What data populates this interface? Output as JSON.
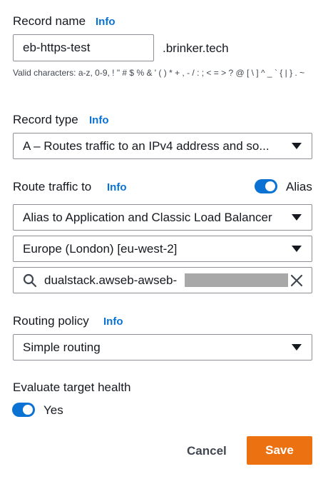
{
  "record_name": {
    "label": "Record name",
    "info": "Info",
    "value": "eb-https-test",
    "suffix": ".brinker.tech",
    "hint": "Valid characters: a-z, 0-9, ! \" # $ % & ' ( ) * + , - / : ; < = > ? @ [ \\ ] ^ _ ` { | } . ~"
  },
  "record_type": {
    "label": "Record type",
    "info": "Info",
    "value": "A – Routes traffic to an IPv4 address and so..."
  },
  "route_traffic": {
    "label": "Route traffic to",
    "info": "Info",
    "alias_label": "Alias",
    "alias_on": true,
    "endpoint_type": "Alias to Application and Classic Load Balancer",
    "region": "Europe (London) [eu-west-2]",
    "search_value": "dualstack.awseb-awseb-"
  },
  "routing_policy": {
    "label": "Routing policy",
    "info": "Info",
    "value": "Simple routing"
  },
  "evaluate_health": {
    "label": "Evaluate target health",
    "value_label": "Yes",
    "on": true
  },
  "actions": {
    "cancel": "Cancel",
    "save": "Save"
  },
  "colors": {
    "accent": "#0972d3",
    "save": "#ec7211",
    "text": "#16191f"
  }
}
